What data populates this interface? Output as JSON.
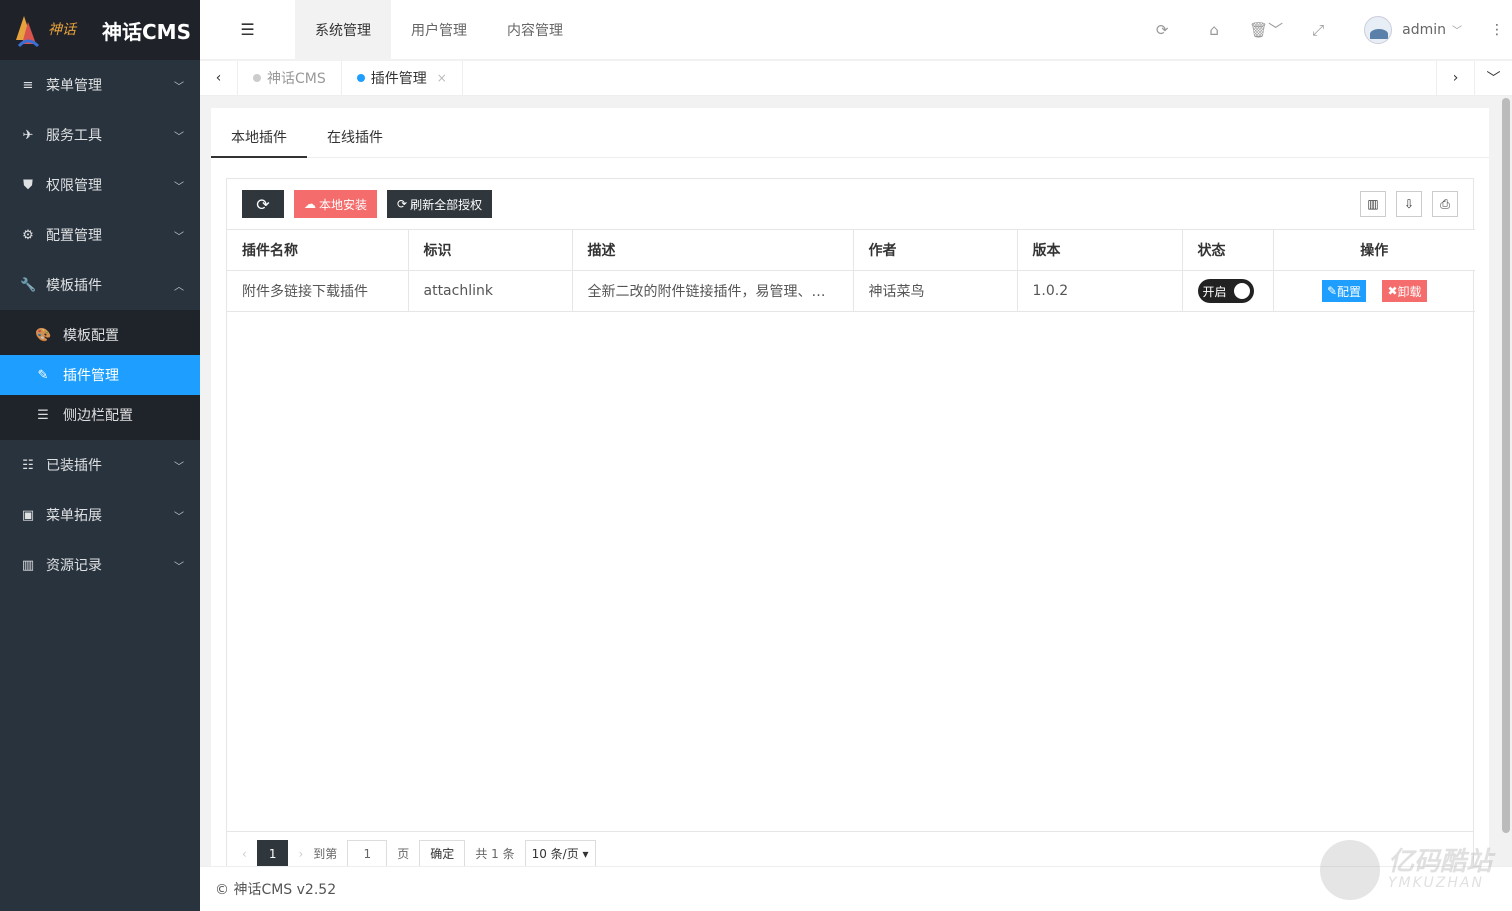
{
  "app": {
    "logo_text": "神话CMS"
  },
  "sidebar": {
    "items": [
      {
        "label": "菜单管理",
        "icon": "≡"
      },
      {
        "label": "服务工具",
        "icon": "✈"
      },
      {
        "label": "权限管理",
        "icon": "⛊"
      },
      {
        "label": "配置管理",
        "icon": "⚙"
      },
      {
        "label": "模板插件",
        "icon": "🔧"
      }
    ],
    "sub_items": [
      {
        "label": "模板配置",
        "icon": "🎨"
      },
      {
        "label": "插件管理",
        "icon": "✎"
      },
      {
        "label": "侧边栏配置",
        "icon": "☰"
      }
    ],
    "items_after": [
      {
        "label": "已装插件",
        "icon": "☷"
      },
      {
        "label": "菜单拓展",
        "icon": "▣"
      },
      {
        "label": "资源记录",
        "icon": "▥"
      }
    ]
  },
  "header": {
    "tabs": [
      "系统管理",
      "用户管理",
      "内容管理"
    ],
    "user": "admin"
  },
  "pagetabs": {
    "tabs": [
      {
        "label": "神话CMS"
      },
      {
        "label": "插件管理"
      }
    ]
  },
  "content": {
    "tabs": [
      "本地插件",
      "在线插件"
    ],
    "toolbar": {
      "install": "本地安装",
      "refresh_auth": "刷新全部授权"
    },
    "table": {
      "headers": [
        "插件名称",
        "标识",
        "描述",
        "作者",
        "版本",
        "状态",
        "操作"
      ],
      "rows": [
        {
          "name": "附件多链接下载插件",
          "id": "attachlink",
          "desc": "全新二改的附件链接插件，易管理、…",
          "author": "神话菜鸟",
          "version": "1.0.2",
          "status": "开启",
          "config": "配置",
          "uninstall": "卸载"
        }
      ]
    },
    "pager": {
      "current": "1",
      "goto_label": "到第",
      "goto_value": "1",
      "page_label": "页",
      "confirm": "确定",
      "total": "共 1 条",
      "per_page": "10 条/页"
    }
  },
  "footer": {
    "text": "© 神话CMS v2.52"
  },
  "watermark": {
    "main": "亿码酷站",
    "sub": "YMKUZHAN"
  },
  "colors": {
    "sidebar_bg": "#28333e",
    "active_blue": "#1e9fff",
    "danger": "#f56c6c",
    "dark": "#2f363c"
  }
}
